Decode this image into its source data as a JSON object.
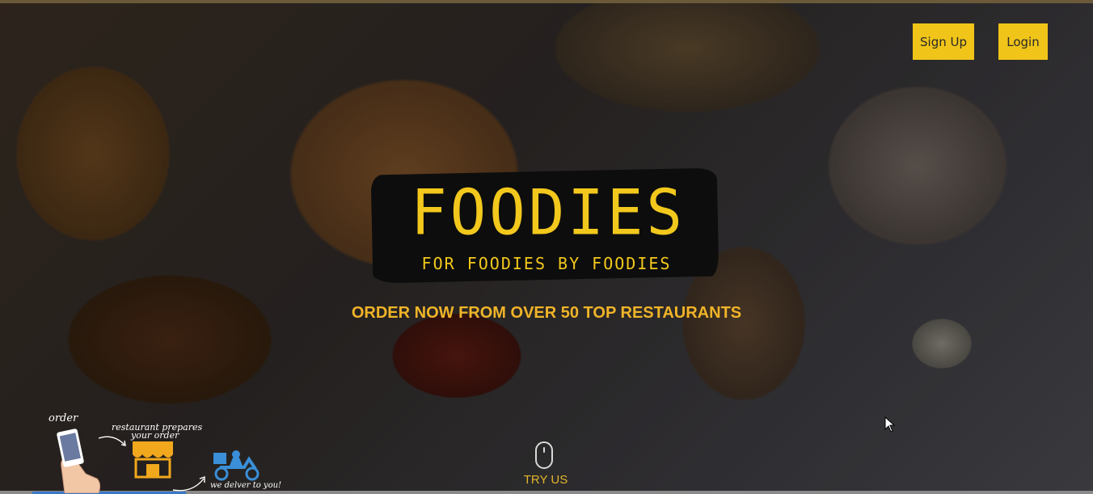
{
  "nav": {
    "signup_label": "Sign Up",
    "login_label": "Login"
  },
  "logo": {
    "title": "FOODIES",
    "tagline": "FOR FOODIES BY FOODIES"
  },
  "hero": {
    "headline": "ORDER NOW FROM OVER 50 TOP RESTAURANTS",
    "cta_label": "TRY US"
  },
  "steps": {
    "order_label": "order",
    "prepare_label_line1": "restaurant prepares",
    "prepare_label_line2": "your order",
    "deliver_label": "we delver to you!"
  },
  "icons": {
    "scroll": "mouse-scroll-icon",
    "phone": "phone-hand-icon",
    "store": "storefront-icon",
    "delivery": "delivery-scooter-icon",
    "cursor": "mouse-pointer-icon"
  },
  "colors": {
    "accent": "#f0c419",
    "headline": "#f0b428",
    "logo_text": "#f2c81c",
    "logo_bg": "#0d0d0d"
  }
}
